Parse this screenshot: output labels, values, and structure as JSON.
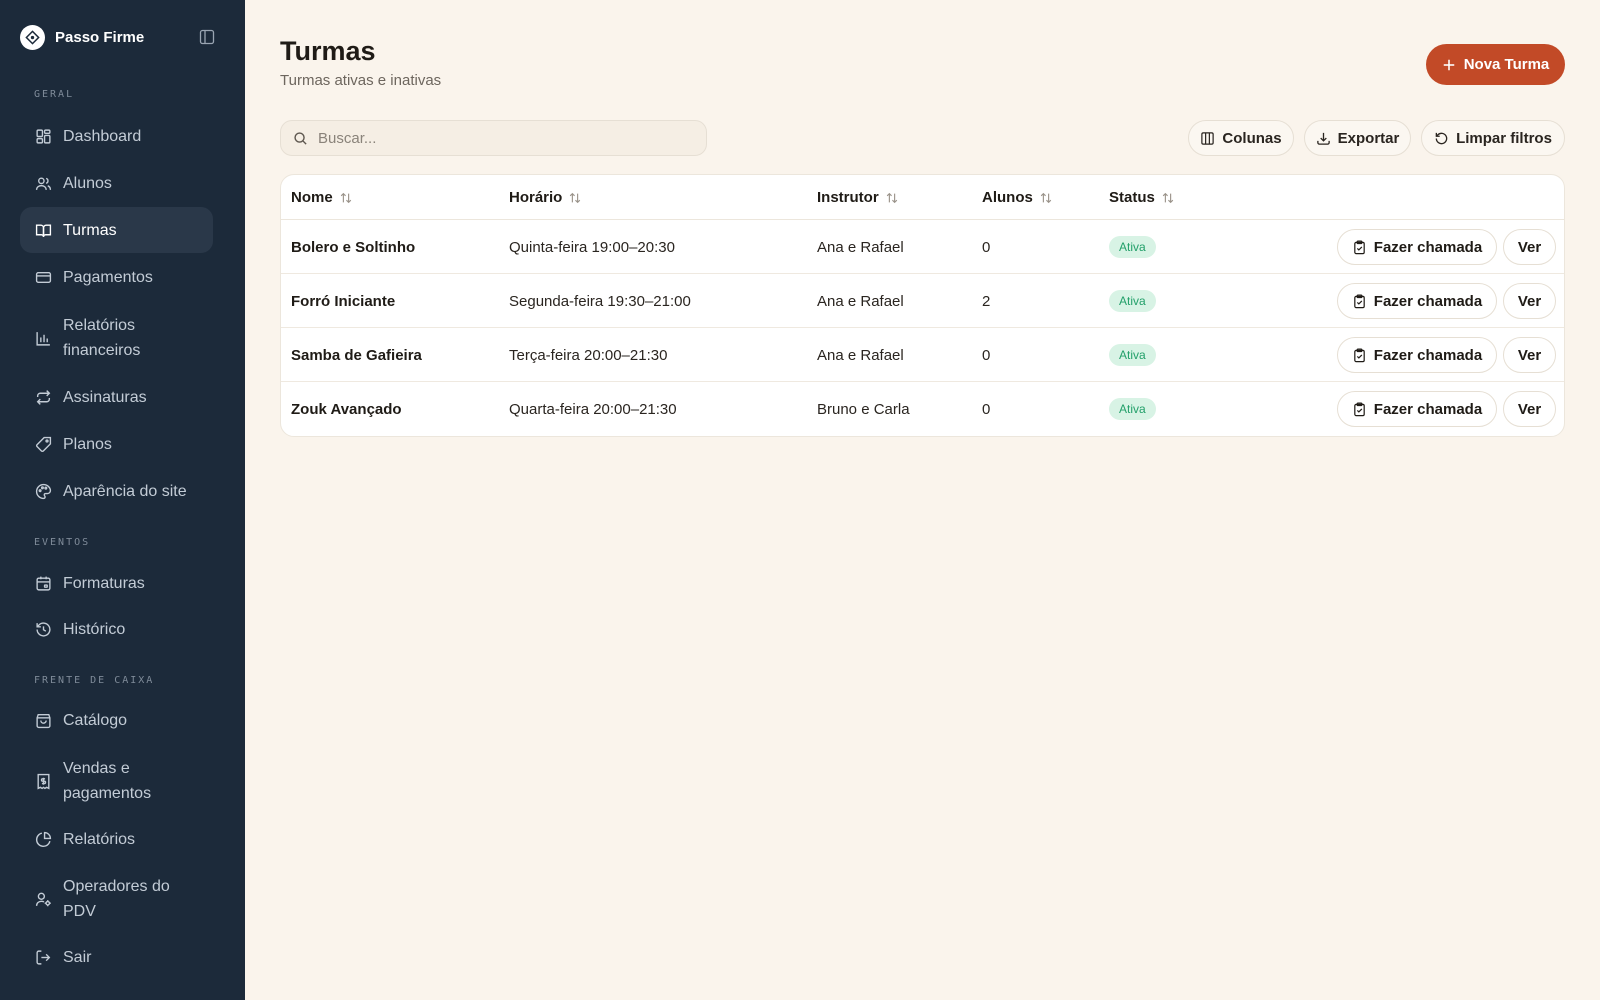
{
  "app": {
    "name": "Passo Firme"
  },
  "sidebar": {
    "sections": [
      {
        "label": "GERAL"
      },
      {
        "label": "EVENTOS"
      },
      {
        "label": "FRENTE DE CAIXA"
      }
    ],
    "items": [
      {
        "label": "Dashboard",
        "icon": "layout-dashboard-icon"
      },
      {
        "label": "Alunos",
        "icon": "users-icon"
      },
      {
        "label": "Turmas",
        "icon": "book-open-icon",
        "active": true
      },
      {
        "label": "Pagamentos",
        "icon": "credit-card-icon"
      },
      {
        "label": "Relatórios financeiros",
        "icon": "bar-chart-icon"
      },
      {
        "label": "Assinaturas",
        "icon": "repeat-icon"
      },
      {
        "label": "Planos",
        "icon": "tag-icon"
      },
      {
        "label": "Aparência do site",
        "icon": "palette-icon"
      },
      {
        "label": "Formaturas",
        "icon": "calendar-icon"
      },
      {
        "label": "Histórico",
        "icon": "history-icon"
      },
      {
        "label": "Catálogo",
        "icon": "shopping-bag-icon"
      },
      {
        "label": "Vendas e pagamentos",
        "icon": "receipt-icon"
      },
      {
        "label": "Relatórios",
        "icon": "pie-chart-icon"
      },
      {
        "label": "Operadores do PDV",
        "icon": "user-cog-icon"
      },
      {
        "label": "Sair",
        "icon": "log-out-icon"
      }
    ]
  },
  "header": {
    "title": "Turmas",
    "subtitle": "Turmas ativas e inativas",
    "new_button": "Nova Turma"
  },
  "toolbar": {
    "search_placeholder": "Buscar...",
    "columns_label": "Colunas",
    "export_label": "Exportar",
    "clear_filters_label": "Limpar filtros"
  },
  "table": {
    "columns": [
      "Nome",
      "Horário",
      "Instrutor",
      "Alunos",
      "Status"
    ],
    "rows": [
      {
        "nome": "Bolero e Soltinho",
        "horario": "Quinta-feira 19:00–20:30",
        "instrutor": "Ana e Rafael",
        "alunos": "0",
        "status": "Ativa"
      },
      {
        "nome": "Forró Iniciante",
        "horario": "Segunda-feira 19:30–21:00",
        "instrutor": "Ana e Rafael",
        "alunos": "2",
        "status": "Ativa"
      },
      {
        "nome": "Samba de Gafieira",
        "horario": "Terça-feira 20:00–21:30",
        "instrutor": "Ana e Rafael",
        "alunos": "0",
        "status": "Ativa"
      },
      {
        "nome": "Zouk Avançado",
        "horario": "Quarta-feira 20:00–21:30",
        "instrutor": "Bruno e Carla",
        "alunos": "0",
        "status": "Ativa"
      }
    ],
    "row_actions": {
      "attendance": "Fazer chamada",
      "view": "Ver"
    }
  },
  "colors": {
    "sidebar_bg": "#1c2a3a",
    "page_bg": "#faf4ec",
    "accent": "#c24a27",
    "status_active_bg": "#d8f3e5",
    "status_active_text": "#23a06a"
  }
}
